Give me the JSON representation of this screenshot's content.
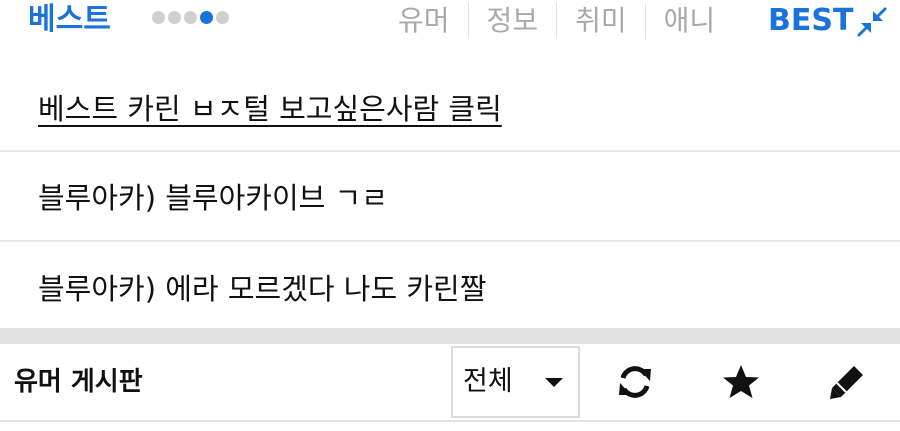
{
  "best_header": {
    "title": "베스트",
    "page_dots": {
      "count": 5,
      "active_index": 3
    },
    "tabs": [
      "유머",
      "정보",
      "취미",
      "애니"
    ],
    "best_label": "BEST",
    "icons": {
      "collapse": "collapse-arrows-icon"
    },
    "colors": {
      "accent": "#1a73d8",
      "tab_text": "#a9a9a9",
      "dot_inactive": "#cfcfcf"
    }
  },
  "posts": [
    {
      "title": "베스트 카린 ㅂㅈ털 보고싶은사람 클릭"
    },
    {
      "title": "블루아카) 블루아카이브 ㄱㄹ"
    },
    {
      "title": "블루아카) 에라 모르겠다 나도 카린짤"
    }
  ],
  "board": {
    "title": "유머 게시판",
    "filter": {
      "selected": "전체"
    },
    "icons": {
      "refresh": "refresh-icon",
      "favorite": "star-icon",
      "write": "pencil-icon"
    }
  }
}
